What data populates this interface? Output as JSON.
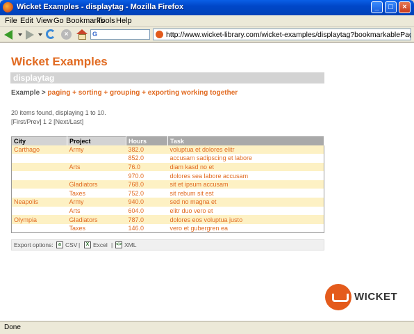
{
  "window": {
    "title": "Wicket Examples - displaytag - Mozilla Firefox",
    "controls": {
      "minimize": "_",
      "maximize": "□",
      "close": "×"
    }
  },
  "menu": [
    "File",
    "Edit",
    "View",
    "Go",
    "Bookmarks",
    "Tools",
    "Help"
  ],
  "toolbar": {
    "url": "http://www.wicket-library.com/wicket-examples/displaytag?bookmarkablePage=wicket.examples.displaytag.ExampleSubsets",
    "search_glyph": "G"
  },
  "page": {
    "title": "Wicket Examples",
    "subtitle": "displaytag",
    "breadcrumb_prefix": "Example >",
    "breadcrumb_link": "paging + sorting + grouping + exporting working together",
    "items_found": "20 items found, displaying 1 to 10.",
    "pager": {
      "first_prev": "[First/Prev]",
      "p1": "1",
      "p2": "2",
      "next_last": "[Next/Last]"
    }
  },
  "table": {
    "headers": [
      "City",
      "Project",
      "Hours",
      "Task"
    ],
    "rows": [
      {
        "city": "Carthago",
        "project": "Army",
        "hours": "382.0",
        "task": "voluptua et dolores elitr"
      },
      {
        "city": "",
        "project": "",
        "hours": "852.0",
        "task": "accusam sadipscing et labore"
      },
      {
        "city": "",
        "project": "Arts",
        "hours": "76.0",
        "task": "diam kasd no et"
      },
      {
        "city": "",
        "project": "",
        "hours": "970.0",
        "task": "dolores sea labore accusam"
      },
      {
        "city": "",
        "project": "Gladiators",
        "hours": "768.0",
        "task": "sit et ipsum accusam"
      },
      {
        "city": "",
        "project": "Taxes",
        "hours": "752.0",
        "task": "sit rebum sit est"
      },
      {
        "city": "Neapolis",
        "project": "Army",
        "hours": "940.0",
        "task": "sed no magna et"
      },
      {
        "city": "",
        "project": "Arts",
        "hours": "604.0",
        "task": "elitr duo vero et"
      },
      {
        "city": "Olympia",
        "project": "Gladiators",
        "hours": "787.0",
        "task": "dolores eos voluptua justo"
      },
      {
        "city": "",
        "project": "Taxes",
        "hours": "146.0",
        "task": "vero et gubergren ea"
      }
    ]
  },
  "export": {
    "label": "Export options:",
    "csv": "CSV",
    "excel": "Excel",
    "xml": "XML",
    "sep": "|"
  },
  "logo": {
    "word": "WICKET"
  },
  "status": "Done",
  "colors": {
    "accent": "#e16b22",
    "row_odd": "#fdf1c4",
    "header_bg": "#d3d3d3"
  }
}
